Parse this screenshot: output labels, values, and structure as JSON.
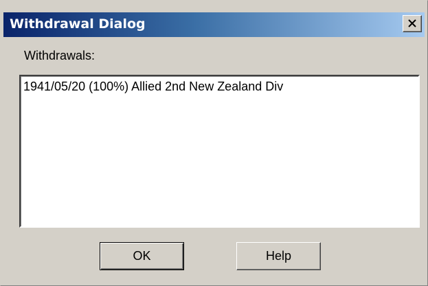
{
  "window": {
    "title": "Withdrawal Dialog",
    "close_icon": "close-icon"
  },
  "withdrawals": {
    "label": "Withdrawals:",
    "items": [
      "1941/05/20 (100%) Allied 2nd New Zealand Div"
    ]
  },
  "buttons": {
    "ok_label": "OK",
    "help_label": "Help"
  },
  "colors": {
    "titlebar_start": "#0a246a",
    "titlebar_end": "#a6caf0",
    "face": "#d4d0c8"
  }
}
